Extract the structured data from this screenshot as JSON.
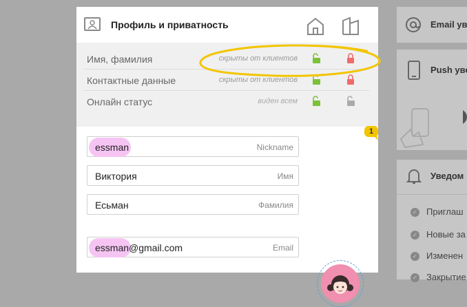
{
  "card": {
    "title": "Профиль и приватность",
    "privacy_rows": [
      {
        "label": "Имя, фамилия",
        "value": "скрыты от клиентов"
      },
      {
        "label": "Контактные данные",
        "value": "скрыты от клиентов"
      },
      {
        "label": "Онлайн статус",
        "value": "виден всем"
      }
    ],
    "fields": {
      "nickname": {
        "value": "essman",
        "placeholder": "Nickname"
      },
      "first_name": {
        "value": "Виктория",
        "placeholder": "Имя"
      },
      "last_name": {
        "value": "Есьман",
        "placeholder": "Фамилия"
      },
      "email": {
        "value": "essman@gmail.com",
        "placeholder": "Email"
      }
    },
    "badge_count": "1"
  },
  "right_panels": {
    "email": {
      "title": "Email уве"
    },
    "push": {
      "title": "Push уве"
    },
    "notifications": {
      "title": "Уведом",
      "items": [
        "Приглаш",
        "Новые за",
        "Изменен",
        "Закрытие"
      ]
    }
  },
  "colors": {
    "accent_yellow": "#f2c500",
    "lock_green": "#7cc13a",
    "lock_red": "#f06a6a",
    "avatar_pink": "#f08fb0",
    "highlight_pink": "#f6c4f3"
  }
}
